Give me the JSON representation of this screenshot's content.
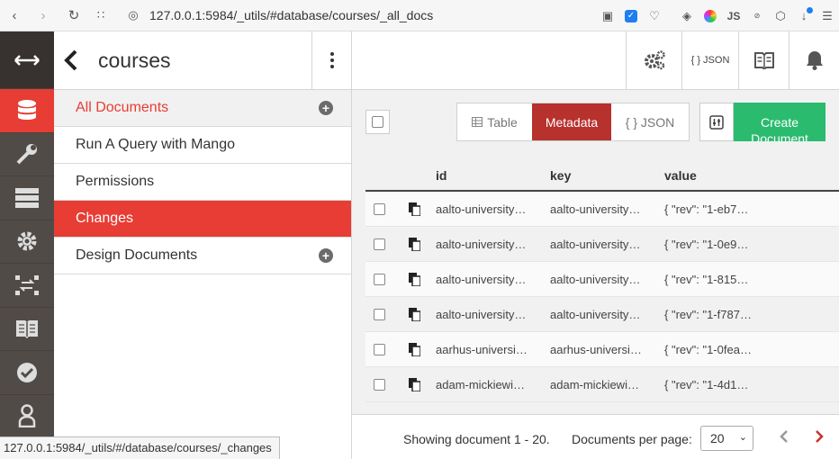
{
  "browser": {
    "url": "127.0.0.1:5984/_utils/#database/courses/_all_docs",
    "ext_js": "JS"
  },
  "sidebar": {
    "title": "courses",
    "items": [
      {
        "label": "All Documents"
      },
      {
        "label": "Run A Query with Mango"
      },
      {
        "label": "Permissions"
      },
      {
        "label": "Changes"
      },
      {
        "label": "Design Documents"
      }
    ]
  },
  "header": {
    "json_label": "{ } JSON"
  },
  "toolbar": {
    "view_table": "Table",
    "view_metadata": "Metadata",
    "view_json": "{ } JSON",
    "create_label": "Create Document"
  },
  "table": {
    "columns": [
      "id",
      "key",
      "value"
    ],
    "rows": [
      {
        "id": "aalto-university…",
        "key": "aalto-university…",
        "value": "{ \"rev\": \"1-eb7…"
      },
      {
        "id": "aalto-university…",
        "key": "aalto-university…",
        "value": "{ \"rev\": \"1-0e9…"
      },
      {
        "id": "aalto-university…",
        "key": "aalto-university…",
        "value": "{ \"rev\": \"1-815…"
      },
      {
        "id": "aalto-university…",
        "key": "aalto-university…",
        "value": "{ \"rev\": \"1-f787…"
      },
      {
        "id": "aarhus-universi…",
        "key": "aarhus-universi…",
        "value": "{ \"rev\": \"1-0fea…"
      },
      {
        "id": "adam-mickiewi…",
        "key": "adam-mickiewi…",
        "value": "{ \"rev\": \"1-4d1…"
      }
    ]
  },
  "footer": {
    "showing": "Showing document 1 - 20.",
    "per_page_label": "Documents per page:",
    "per_page_value": "20"
  },
  "status_link": "127.0.0.1:5984/_utils/#/database/courses/_changes",
  "colors": {
    "accent": "#e73d34",
    "active_segment": "#b7312d",
    "create": "#2bbb6f",
    "rail": "#514b48"
  }
}
